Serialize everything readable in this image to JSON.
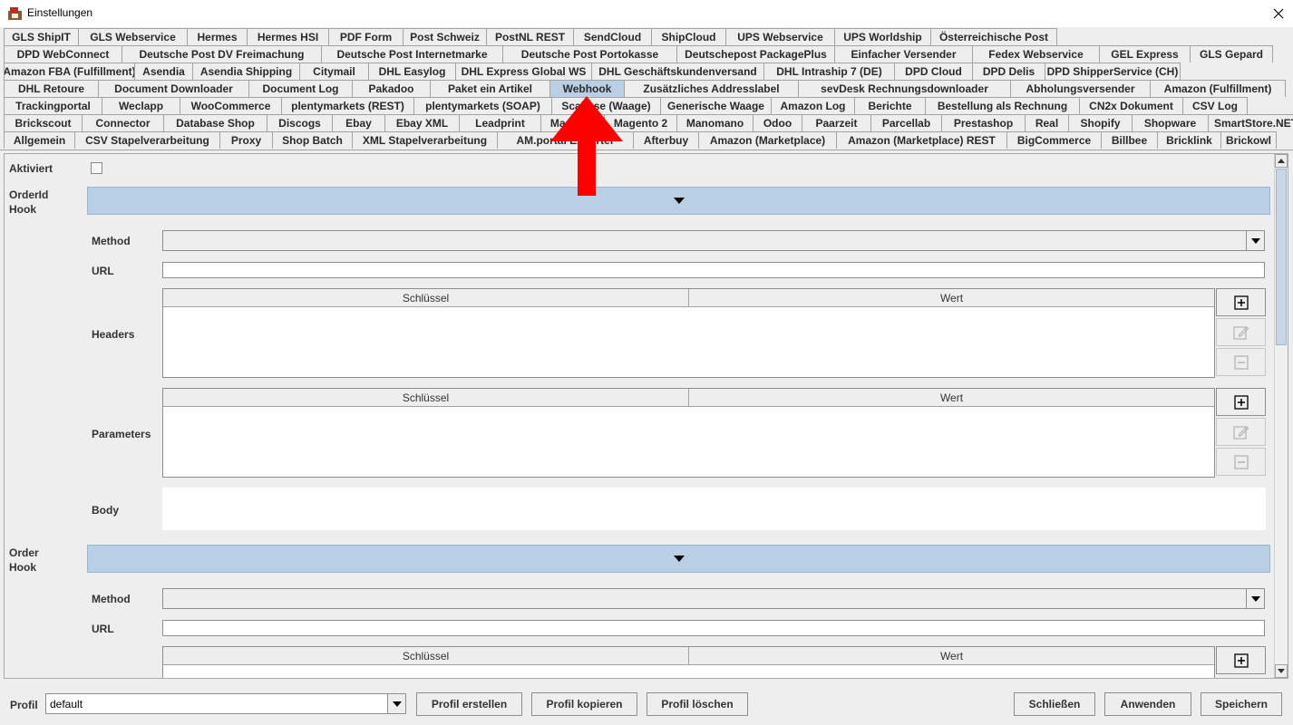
{
  "window": {
    "title": "Einstellungen"
  },
  "tabs": {
    "selected": "Webhook",
    "rows": [
      [
        [
          "GLS ShipIT",
          82
        ],
        [
          "GLS Webservice",
          120
        ],
        [
          "Hermes",
          66
        ],
        [
          "Hermes HSI",
          90
        ],
        [
          "PDF Form",
          82
        ],
        [
          "Post Schweiz",
          92
        ],
        [
          "PostNL REST",
          96
        ],
        [
          "SendCloud",
          86
        ],
        [
          "ShipCloud",
          82
        ],
        [
          "UPS Webservice",
          120
        ],
        [
          "UPS Worldship",
          106
        ],
        [
          "Österreichische Post",
          140
        ]
      ],
      [
        [
          "DPD WebConnect",
          130
        ],
        [
          "Deutsche Post DV Freimachung",
          220
        ],
        [
          "Deutsche Post Internetmarke",
          200
        ],
        [
          "Deutsche Post Portokasse",
          192
        ],
        [
          "Deutschepost PackagePlus",
          174
        ],
        [
          "Einfacher Versender",
          152
        ],
        [
          "Fedex Webservice",
          140
        ],
        [
          "GEL Express",
          100
        ],
        [
          "GLS Gepard",
          92
        ]
      ],
      [
        [
          "Amazon FBA (Fulfillment)",
          144
        ],
        [
          "Asendia",
          64
        ],
        [
          "Asendia Shipping",
          118
        ],
        [
          "Citymail",
          76
        ],
        [
          "DHL Easylog",
          96
        ],
        [
          "DHL Express Global WS",
          150
        ],
        [
          "DHL Geschäftskundenversand",
          190
        ],
        [
          "DHL Intraship 7 (DE)",
          144
        ],
        [
          "DPD Cloud",
          86
        ],
        [
          "DPD Delis",
          80
        ],
        [
          "DPD ShipperService (CH)",
          150
        ]
      ],
      [
        [
          "DHL Retoure",
          104
        ],
        [
          "Document Downloader",
          166
        ],
        [
          "Document Log",
          114
        ],
        [
          "Pakadoo",
          86
        ],
        [
          "Paket ein Artikel",
          132
        ],
        [
          "Webhook",
          82
        ],
        [
          "Zusätzliches Addresslabel",
          192
        ],
        [
          "sevDesk Rechnungsdownloader",
          234
        ],
        [
          "Abholungsversender",
          154
        ],
        [
          "Amazon (Fulfillment)",
          150
        ]
      ],
      [
        [
          "Trackingportal",
          108
        ],
        [
          "Weclapp",
          86
        ],
        [
          "WooCommerce",
          112
        ],
        [
          "plentymarkets (REST)",
          146
        ],
        [
          "plentymarkets (SOAP)",
          152
        ],
        [
          "Scalipse (Waage)",
          120
        ],
        [
          "Generische Waage",
          122
        ],
        [
          "Amazon Log",
          92
        ],
        [
          "Berichte",
          78
        ],
        [
          "Bestellung als Rechnung",
          170
        ],
        [
          "CN2x Dokument",
          114
        ],
        [
          "CSV Log",
          72
        ]
      ],
      [
        [
          "Brickscout",
          86
        ],
        [
          "Connector",
          90
        ],
        [
          "Database Shop",
          114
        ],
        [
          "Discogs",
          72
        ],
        [
          "Ebay",
          58
        ],
        [
          "Ebay XML",
          82
        ],
        [
          "Leadprint",
          90
        ],
        [
          "Magento",
          70
        ],
        [
          "Magento 2",
          80
        ],
        [
          "Manomano",
          84
        ],
        [
          "Odoo",
          54
        ],
        [
          "Paarzeit",
          76
        ],
        [
          "Parcellab",
          78
        ],
        [
          "Prestashop",
          92
        ],
        [
          "Real",
          48
        ],
        [
          "Shopify",
          70
        ],
        [
          "Shopware",
          84
        ],
        [
          "SmartStore.NET",
          106
        ]
      ],
      [
        [
          "Allgemein",
          78
        ],
        [
          "CSV Stapelverarbeitung",
          160
        ],
        [
          "Proxy",
          58
        ],
        [
          "Shop Batch",
          88
        ],
        [
          "XML Stapelverarbeitung",
          160
        ],
        [
          "AM.portal Exporter",
          150
        ],
        [
          "Afterbuy",
          72
        ],
        [
          "Amazon (Marketplace)",
          152
        ],
        [
          "Amazon (Marketplace) REST",
          188
        ],
        [
          "BigCommerce",
          104
        ],
        [
          "Billbee",
          62
        ],
        [
          "Bricklink",
          70
        ],
        [
          "Brickowl",
          62
        ]
      ]
    ]
  },
  "form": {
    "aktiviert_label": "Aktiviert",
    "orderid_hook_label": "OrderId\nHook",
    "order_hook_label": "Order\nHook",
    "method_label": "Method",
    "url_label": "URL",
    "headers_label": "Headers",
    "parameters_label": "Parameters",
    "body_label": "Body",
    "col_key": "Schlüssel",
    "col_value": "Wert"
  },
  "bottom": {
    "profil_label": "Profil",
    "profil_value": "default",
    "create_btn": "Profil erstellen",
    "copy_btn": "Profil kopieren",
    "delete_btn": "Profil löschen",
    "close_btn": "Schließen",
    "apply_btn": "Anwenden",
    "save_btn": "Speichern"
  },
  "colors": {
    "selected_tab": "#b8cfe5",
    "annotation_arrow": "#ff0000"
  },
  "icons": {
    "app": "app-icon",
    "close": "close-icon",
    "add": "plus-square-icon",
    "edit": "pencil-icon",
    "remove": "minus-square-icon"
  }
}
